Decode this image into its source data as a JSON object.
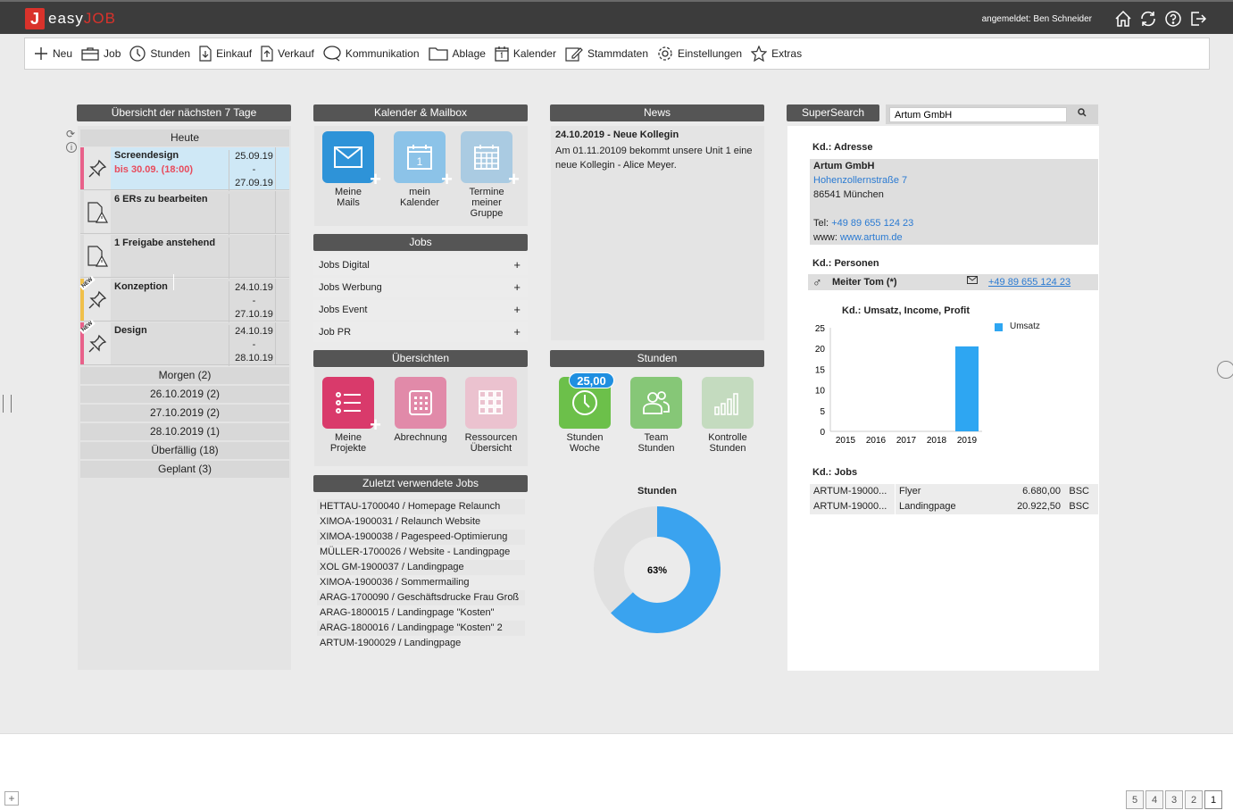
{
  "app": {
    "logo_letter": "J",
    "logo_text_a": "easy",
    "logo_text_b": "JOB",
    "user": "angemeldet: Ben Schneider"
  },
  "toolbar": [
    {
      "label": "Neu",
      "icon": "plus-icon"
    },
    {
      "label": "Job",
      "icon": "briefcase-icon"
    },
    {
      "label": "Stunden",
      "icon": "clock-icon"
    },
    {
      "label": "Einkauf",
      "icon": "doc-in-icon"
    },
    {
      "label": "Verkauf",
      "icon": "doc-out-icon"
    },
    {
      "label": "Kommunikation",
      "icon": "chat-icon"
    },
    {
      "label": "Ablage",
      "icon": "folder-icon"
    },
    {
      "label": "Kalender",
      "icon": "calendar-icon"
    },
    {
      "label": "Stammdaten",
      "icon": "edit-icon"
    },
    {
      "label": "Einstellungen",
      "icon": "gear-icon"
    },
    {
      "label": "Extras",
      "icon": "star-icon"
    }
  ],
  "week": {
    "title": "Übersicht der nächsten 7 Tage",
    "today": "Heute",
    "tasks": [
      {
        "title": "Screendesign",
        "sub": "bis 30.09. (18:00)",
        "d1": "25.09.19",
        "dash": "-",
        "d2": "27.09.19",
        "color": "#e8618a",
        "icon": "pin",
        "bg": "#cfe8f6"
      },
      {
        "title": "6 ERs zu bearbeiten",
        "sub": "",
        "d1": "",
        "dash": "",
        "d2": "",
        "color": "",
        "icon": "warn",
        "bg": "#dcdcdc"
      },
      {
        "title": "1 Freigabe anstehend",
        "sub": "",
        "d1": "",
        "dash": "",
        "d2": "",
        "color": "",
        "icon": "warn",
        "bg": "#dcdcdc"
      },
      {
        "title": "Konzeption",
        "sub": "",
        "d1": "24.10.19",
        "dash": "-",
        "d2": "27.10.19",
        "color": "#f0c04a",
        "icon": "pin",
        "bg": "#dcdcdc",
        "new": "NEW"
      },
      {
        "title": "Design",
        "sub": "",
        "d1": "24.10.19",
        "dash": "-",
        "d2": "28.10.19",
        "color": "#e8618a",
        "icon": "pin",
        "bg": "#dcdcdc",
        "new": "NEW"
      }
    ],
    "rows": [
      "Morgen (2)",
      "26.10.2019 (2)",
      "27.10.2019 (2)",
      "28.10.2019 (1)",
      "Überfällig (18)",
      "Geplant (3)"
    ]
  },
  "kal": {
    "title": "Kalender & Mailbox",
    "tiles": [
      {
        "l1": "Meine",
        "l2": "Mails",
        "l3": ""
      },
      {
        "l1": "mein",
        "l2": "Kalender",
        "l3": ""
      },
      {
        "l1": "Termine",
        "l2": "meiner",
        "l3": "Gruppe"
      }
    ]
  },
  "jobs": {
    "title": "Jobs",
    "items": [
      "Jobs Digital",
      "Jobs Werbung",
      "Jobs Event",
      "Job PR"
    ],
    "plus": "+"
  },
  "uebersichten": {
    "title": "Übersichten",
    "tiles": [
      {
        "l1": "Meine",
        "l2": "Projekte"
      },
      {
        "l1": "Abrechnung",
        "l2": ""
      },
      {
        "l1": "Ressourcen",
        "l2": "Übersicht"
      }
    ]
  },
  "recent": {
    "title": "Zuletzt verwendete Jobs",
    "items": [
      "HETTAU-1700040 / Homepage Relaunch",
      "XIMOA-1900031 / Relaunch Website",
      "XIMOA-1900038 / Pagespeed-Optimierung",
      "MÜLLER-1700026 / Website - Landingpage",
      "XOL GM-1900037 / Landingpage",
      "XIMOA-1900036 / Sommermailing",
      "ARAG-1700090 / Geschäftsdrucke Frau Groß",
      "ARAG-1800015 / Landingpage \"Kosten\"",
      "ARAG-1800016 / Landingpage \"Kosten\" 2",
      "ARTUM-1900029 / Landingpage"
    ]
  },
  "news": {
    "title": "News",
    "heading": "24.10.2019 - Neue Kollegin",
    "body": "Am 01.11.20109 bekommt unsere Unit 1 eine neue Kollegin - Alice Meyer."
  },
  "stunden": {
    "title": "Stunden",
    "badge": "25,00",
    "tiles": [
      {
        "l1": "Stunden",
        "l2": "Woche"
      },
      {
        "l1": "Team",
        "l2": "Stunden"
      },
      {
        "l1": "Kontrolle",
        "l2": "Stunden"
      }
    ],
    "donut_title": "Stunden",
    "donut_label": "63%",
    "donut_value": 63
  },
  "ss": {
    "title": "SuperSearch",
    "query": "Artum GmbH",
    "addr_title": "Kd.: Adresse",
    "company": "Artum GmbH",
    "street": "Hohenzollernstraße 7",
    "city": "86541 München",
    "tel_label": "Tel: ",
    "tel": "+49 89 655 124 23",
    "www_label": "www: ",
    "www": "www.artum.de",
    "pers_title": "Kd.: Personen",
    "person": "Meiter Tom (*)",
    "person_tel": "+49 89 655 124 23",
    "jobs_title": "Kd.: Jobs",
    "jobs": [
      {
        "nr": "ARTUM-19000...",
        "name": "Flyer",
        "amount": "6.680,00",
        "cur": "BSC"
      },
      {
        "nr": "ARTUM-19000...",
        "name": "Landingpage",
        "amount": "20.922,50",
        "cur": "BSC"
      }
    ]
  },
  "chart_data": {
    "type": "bar",
    "title": "Kd.: Umsatz, Income, Profit",
    "categories": [
      "2015",
      "2016",
      "2017",
      "2018",
      "2019"
    ],
    "series": [
      {
        "name": "Umsatz",
        "values": [
          0,
          0,
          0,
          0,
          20.5
        ]
      }
    ],
    "ylim": [
      0,
      25
    ],
    "yticks": [
      "0",
      "5",
      "10",
      "15",
      "20",
      "25"
    ],
    "legend": "top-right",
    "color": "#2ea6f2"
  },
  "pager": [
    "5",
    "4",
    "3",
    "2",
    "1"
  ],
  "footer_plus": "+"
}
